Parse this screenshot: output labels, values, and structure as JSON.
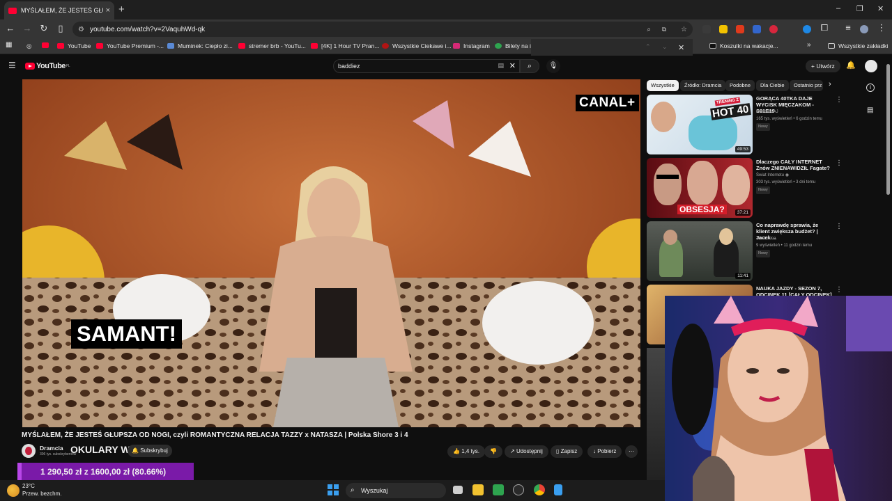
{
  "browser": {
    "tab_title": "MYŚLAŁEM, ŻE JESTEŚ GŁUPSZA",
    "tab_close": "×",
    "new_tab": "+",
    "url": "youtube.com/watch?v=2VaquhWd-qk",
    "window_controls": {
      "minimize": "–",
      "restore": "❐",
      "close": "✕"
    }
  },
  "bookmarks": [
    {
      "label": "YouTube"
    },
    {
      "label": "YouTube Premium -..."
    },
    {
      "label": "Muminek: Ciepło zi..."
    },
    {
      "label": "stremer brb - YouTu..."
    },
    {
      "label": "[4K] 1 Hour TV Pran..."
    },
    {
      "label": "Wszystkie Ciekawe i..."
    },
    {
      "label": "Instagram"
    },
    {
      "label": "Bilety na i"
    },
    {
      "label": "Koszulki na wakacje..."
    },
    {
      "label": "Wszystkie zakładki"
    }
  ],
  "youtube": {
    "logo": "YouTube",
    "logo_region": "PL",
    "search_value": "baddiez",
    "create_label": "Utwórz"
  },
  "video": {
    "broadcaster": "CANAL+",
    "caption": "SAMANT!",
    "title": "MYŚLAŁEM, ŻE JESTEŚ GŁUPSZA OD NOGI, czyli ROMANTYCZNA RELACJA TAZZY x NATASZA | Polska Shore 3 i 4",
    "channel": "Dramcia",
    "subscribers": "306 tys. subskrybentów",
    "overlay_text": "OKULARY W",
    "subscribe_label": "Subskrybuj",
    "likes": "1,4 tys.",
    "share": "Udostępnij",
    "save": "Zapisz",
    "download": "Pobierz"
  },
  "filters": [
    "Wszystkie",
    "Źródło: Dramcia",
    "Podobne",
    "Dla Ciebie",
    "Ostatnio prz"
  ],
  "related": [
    {
      "title": "GORĄCA 40TKA DAJE WYCISK MIĘCZAKOM - S01E19",
      "channel": "Mieczaki AJ",
      "meta": "165 tys. wyświetleń • 6 godzin temu",
      "badge": "Nowy",
      "duration": "49:53",
      "thumb_text": "HOT 40",
      "thumb_sub": "TRENING Z"
    },
    {
      "title": "Dlaczego CAŁY INTERNET Znów ZNIENAWIDZIŁ Fagate?",
      "channel": "Świat Internetu",
      "meta": "303 tys. wyświetleń • 3 dni temu",
      "badge": "Nowy",
      "duration": "37:21",
      "thumb_text": "OBSESJA?"
    },
    {
      "title": "Co naprawdę sprawia, że klient zwiększa budżet? | Jacek ...",
      "channel": "Trust Luna",
      "meta": "9 wyświetleń • 11 godzin temu",
      "badge": "Nowy",
      "duration": "11:41"
    },
    {
      "title": "NAUKA JAZDY - SEZON 7, ODCINEK 11 [CAŁY ODCINEK]",
      "channel": "",
      "meta": "",
      "badge": "",
      "duration": ""
    }
  ],
  "stream": {
    "goal_text": "1 290,50 zł z 1600,00 zł (80.66%)",
    "goal_progress": 0.8066
  },
  "taskbar": {
    "temperature": "23°C",
    "weather": "Przew. bezchm.",
    "search_label": "Wyszukaj"
  },
  "colors": {
    "yt_red": "#ff0033",
    "background": "#0f0f0f",
    "goal_bar": "#7a1aa8"
  }
}
